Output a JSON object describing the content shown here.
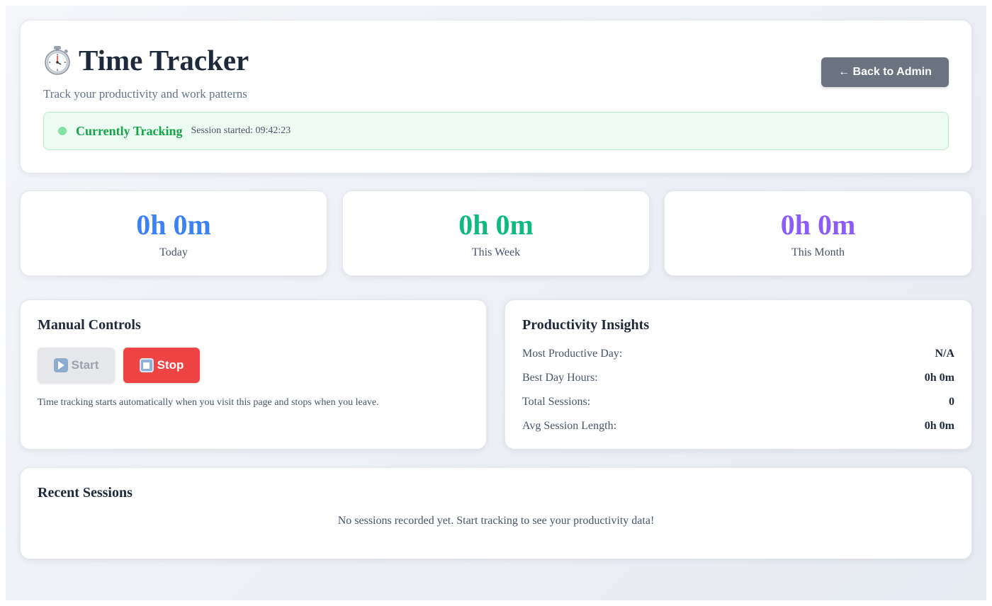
{
  "header": {
    "title": "Time Tracker",
    "subtitle": "Track your productivity and work patterns",
    "back_button": "← Back to Admin",
    "status": {
      "label": "Currently Tracking",
      "session": "Session started: 09:42:23",
      "dot_color": "#86e1a7"
    }
  },
  "stats": [
    {
      "value": "0h 0m",
      "label": "Today",
      "color": "#3b82f6"
    },
    {
      "value": "0h 0m",
      "label": "This Week",
      "color": "#10b981"
    },
    {
      "value": "0h 0m",
      "label": "This Month",
      "color": "#8b5cf6"
    }
  ],
  "controls": {
    "title": "Manual Controls",
    "start_label": "Start",
    "stop_label": "Stop",
    "start_icon": "play-icon",
    "stop_icon": "stop-icon",
    "note": "Time tracking starts automatically when you visit this page and stops when you leave."
  },
  "insights": {
    "title": "Productivity Insights",
    "rows": [
      {
        "label": "Most Productive Day:",
        "value": "N/A"
      },
      {
        "label": "Best Day Hours:",
        "value": "0h 0m"
      },
      {
        "label": "Total Sessions:",
        "value": "0"
      },
      {
        "label": "Avg Session Length:",
        "value": "0h 0m"
      }
    ]
  },
  "sessions": {
    "title": "Recent Sessions",
    "empty_text": "No sessions recorded yet. Start tracking to see your productivity data!"
  },
  "colors": {
    "stop_button": "#ef4444",
    "back_button": "#6b7280",
    "tracking_green": "#16a34a"
  }
}
